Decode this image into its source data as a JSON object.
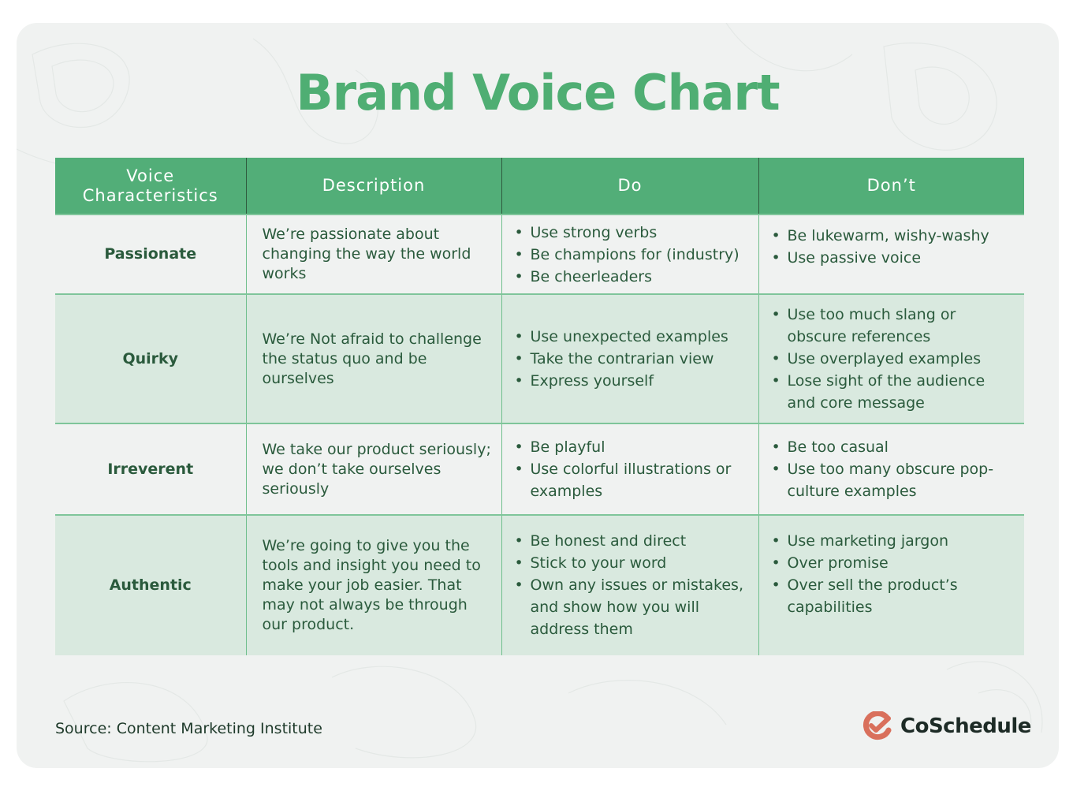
{
  "title": "Brand Voice Chart",
  "table": {
    "headers": [
      "Voice Characteristics",
      "Description",
      "Do",
      "Don’t"
    ],
    "rows": [
      {
        "characteristic": "Passionate",
        "description": "We’re passionate about changing the way the world works",
        "do": [
          "Use strong verbs",
          "Be champions for (industry)",
          "Be cheerleaders"
        ],
        "dont": [
          "Be lukewarm, wishy-washy",
          "Use passive voice"
        ]
      },
      {
        "characteristic": "Quirky",
        "description": "We’re Not afraid to challenge the status quo and be ourselves",
        "do": [
          "Use unexpected examples",
          "Take the contrarian view",
          "Express yourself"
        ],
        "dont": [
          "Use too much slang or obscure references",
          "Use overplayed examples",
          "Lose sight of the audience and core message"
        ]
      },
      {
        "characteristic": "Irreverent",
        "description": "We take our product seriously; we don’t take ourselves seriously",
        "do": [
          "Be playful",
          "Use colorful illustrations or examples"
        ],
        "dont": [
          "Be too casual",
          "Use too many obscure pop-culture examples"
        ]
      },
      {
        "characteristic": "Authentic",
        "description": "We’re going to give you the tools and insight you need to make your job easier. That may not always be through our product.",
        "do": [
          "Be honest and direct",
          "Stick to your word",
          "Own any issues or mistakes, and show how you will address them"
        ],
        "dont": [
          "Use marketing jargon",
          "Over promise",
          "Over sell the product’s capabilities"
        ]
      }
    ]
  },
  "source": "Source: Content Marketing Institute",
  "logo": {
    "name": "CoSchedule",
    "icon": "coschedule-check-icon"
  },
  "colors": {
    "title": "#4fae73",
    "header_bg": "#52ae78",
    "alt_row_bg": "#d9e9df",
    "text": "#2a5a3c",
    "logo_icon": "#d9705c"
  }
}
